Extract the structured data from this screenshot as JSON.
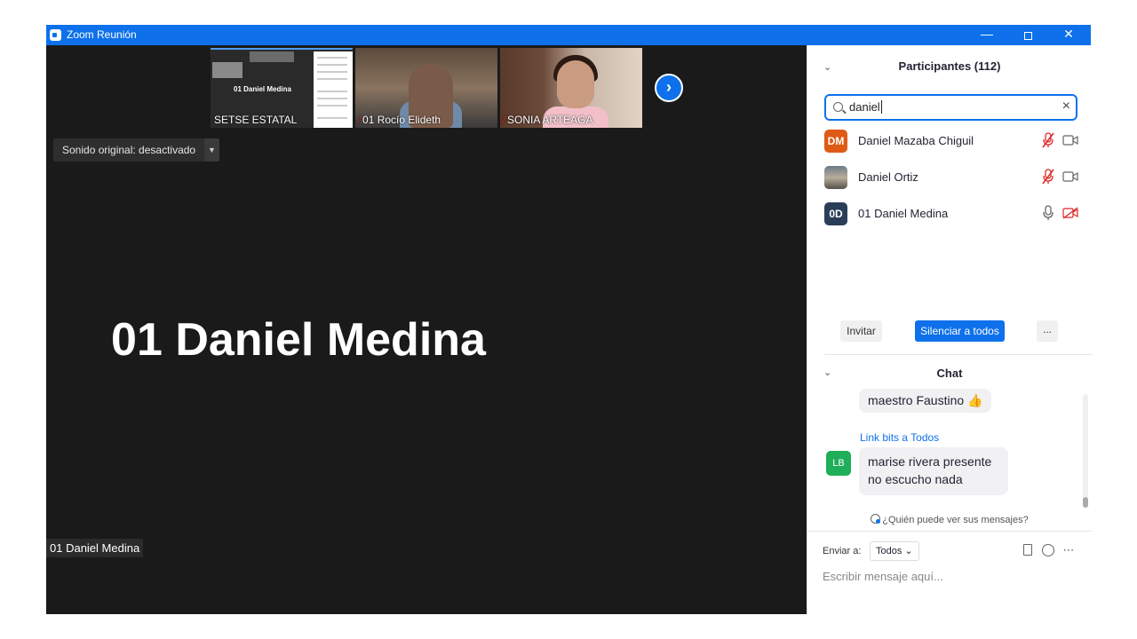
{
  "window": {
    "title": "Zoom Reunión",
    "controls": {
      "minimize": "—",
      "close": "✕"
    }
  },
  "thumbnails": [
    {
      "label": "SETSE ESTATAL",
      "muted": false,
      "inner_text": "01 Daniel Medina"
    },
    {
      "label": "01 Rocío Elideth",
      "muted": true
    },
    {
      "label": "SONIA ARTEAGA",
      "muted": true
    }
  ],
  "video": {
    "original_sound": "Sonido original: desactivado",
    "speaker_name": "01 Daniel Medina",
    "speaker_tag": "01 Daniel Medina"
  },
  "participants": {
    "header": "Participantes (112)",
    "search_value": "daniel",
    "list": [
      {
        "initials": "DM",
        "name": "Daniel Mazaba Chiguil",
        "mic": "muted",
        "video": "on"
      },
      {
        "initials": "",
        "name": "Daniel Ortiz",
        "mic": "muted",
        "video": "on"
      },
      {
        "initials": "0D",
        "name": "01 Daniel Medina",
        "mic": "on",
        "video": "off"
      }
    ],
    "buttons": {
      "invite": "Invitar",
      "mute_all": "Silenciar a todos",
      "more": "..."
    }
  },
  "chat": {
    "header": "Chat",
    "messages": [
      {
        "text": "maestro Faustino 👍"
      },
      {
        "sender": "Link bits a Todos",
        "avatar": "LB",
        "lines": [
          "marise rivera presente",
          "no escucho nada"
        ]
      }
    ],
    "who_can_see": "¿Quién puede ver sus mensajes?",
    "send_to_label": "Enviar a:",
    "send_to_value": "Todos",
    "compose_placeholder": "Escribir mensaje aquí..."
  },
  "colors": {
    "accent": "#0e71eb",
    "muted_red": "#e02828",
    "avatar_dm": "#df5a14",
    "avatar_od": "#2b3e58",
    "avatar_lb": "#1fae59"
  }
}
